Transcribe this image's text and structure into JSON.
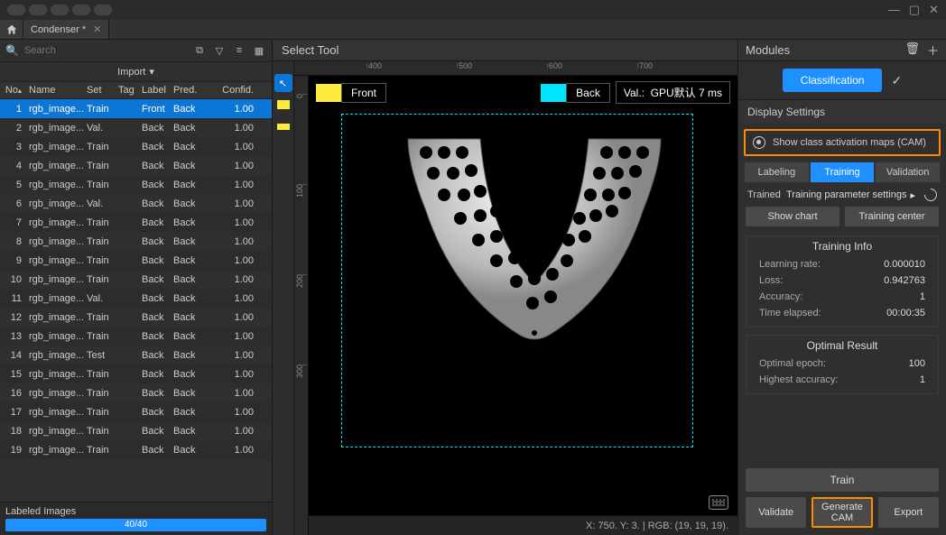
{
  "window": {
    "tab_title": "Condenser *"
  },
  "left": {
    "search_placeholder": "Search",
    "import_label": "Import",
    "columns": {
      "no": "No",
      "name": "Name",
      "set": "Set",
      "tag": "Tag",
      "label": "Label",
      "pred": "Pred.",
      "confid": "Confid."
    },
    "rows": [
      {
        "no": "1",
        "name": "rgb_image...",
        "set": "Train",
        "tag": "",
        "label": "Front",
        "pred": "Back",
        "conf": "1.00",
        "selected": true
      },
      {
        "no": "2",
        "name": "rgb_image...",
        "set": "Val.",
        "tag": "",
        "label": "Back",
        "pred": "Back",
        "conf": "1.00"
      },
      {
        "no": "3",
        "name": "rgb_image...",
        "set": "Train",
        "tag": "",
        "label": "Back",
        "pred": "Back",
        "conf": "1.00"
      },
      {
        "no": "4",
        "name": "rgb_image...",
        "set": "Train",
        "tag": "",
        "label": "Back",
        "pred": "Back",
        "conf": "1.00"
      },
      {
        "no": "5",
        "name": "rgb_image...",
        "set": "Train",
        "tag": "",
        "label": "Back",
        "pred": "Back",
        "conf": "1.00"
      },
      {
        "no": "6",
        "name": "rgb_image...",
        "set": "Val.",
        "tag": "",
        "label": "Back",
        "pred": "Back",
        "conf": "1.00"
      },
      {
        "no": "7",
        "name": "rgb_image...",
        "set": "Train",
        "tag": "",
        "label": "Back",
        "pred": "Back",
        "conf": "1.00"
      },
      {
        "no": "8",
        "name": "rgb_image...",
        "set": "Train",
        "tag": "",
        "label": "Back",
        "pred": "Back",
        "conf": "1.00"
      },
      {
        "no": "9",
        "name": "rgb_image...",
        "set": "Train",
        "tag": "",
        "label": "Back",
        "pred": "Back",
        "conf": "1.00"
      },
      {
        "no": "10",
        "name": "rgb_image...",
        "set": "Train",
        "tag": "",
        "label": "Back",
        "pred": "Back",
        "conf": "1.00"
      },
      {
        "no": "11",
        "name": "rgb_image...",
        "set": "Val.",
        "tag": "",
        "label": "Back",
        "pred": "Back",
        "conf": "1.00"
      },
      {
        "no": "12",
        "name": "rgb_image...",
        "set": "Train",
        "tag": "",
        "label": "Back",
        "pred": "Back",
        "conf": "1.00"
      },
      {
        "no": "13",
        "name": "rgb_image...",
        "set": "Train",
        "tag": "",
        "label": "Back",
        "pred": "Back",
        "conf": "1.00"
      },
      {
        "no": "14",
        "name": "rgb_image...",
        "set": "Test",
        "tag": "",
        "label": "Back",
        "pred": "Back",
        "conf": "1.00"
      },
      {
        "no": "15",
        "name": "rgb_image...",
        "set": "Train",
        "tag": "",
        "label": "Back",
        "pred": "Back",
        "conf": "1.00"
      },
      {
        "no": "16",
        "name": "rgb_image...",
        "set": "Train",
        "tag": "",
        "label": "Back",
        "pred": "Back",
        "conf": "1.00"
      },
      {
        "no": "17",
        "name": "rgb_image...",
        "set": "Train",
        "tag": "",
        "label": "Back",
        "pred": "Back",
        "conf": "1.00"
      },
      {
        "no": "18",
        "name": "rgb_image...",
        "set": "Train",
        "tag": "",
        "label": "Back",
        "pred": "Back",
        "conf": "1.00"
      },
      {
        "no": "19",
        "name": "rgb_image...",
        "set": "Train",
        "tag": "",
        "label": "Back",
        "pred": "Back",
        "conf": "1.00"
      }
    ],
    "footer_label": "Labeled Images",
    "progress_text": "40/40"
  },
  "center": {
    "title": "Select Tool",
    "ruler_h": [
      "400",
      "500",
      "600",
      "700"
    ],
    "ruler_v": [
      "0",
      "100",
      "200",
      "300"
    ],
    "front_label": "Front",
    "back_label": "Back",
    "val_label": "Val.:",
    "gpu_text": "GPU默认 7 ms",
    "status": "X: 750. Y: 3. | RGB: (19, 19, 19).",
    "colors": {
      "front": "#ffeb3b",
      "back": "#00e5ff"
    }
  },
  "right": {
    "modules_title": "Modules",
    "classification_btn": "Classification",
    "display_settings": "Display Settings",
    "cam_toggle": "Show class activation maps (CAM)",
    "tabs": {
      "labeling": "Labeling",
      "training": "Training",
      "validation": "Validation"
    },
    "trained": "Trained",
    "param_settings": "Training parameter settings",
    "show_chart": "Show chart",
    "training_center": "Training center",
    "training_info": "Training Info",
    "info": [
      {
        "k": "Learning rate:",
        "v": "0.000010"
      },
      {
        "k": "Loss:",
        "v": "0.942763"
      },
      {
        "k": "Accuracy:",
        "v": "1"
      },
      {
        "k": "Time elapsed:",
        "v": "00:00:35"
      }
    ],
    "optimal_result": "Optimal Result",
    "optimal": [
      {
        "k": "Optimal epoch:",
        "v": "100"
      },
      {
        "k": "Highest accuracy:",
        "v": "1"
      }
    ],
    "train_btn": "Train",
    "validate_btn": "Validate",
    "generate_cam_btn": "Generate CAM",
    "export_btn": "Export"
  }
}
